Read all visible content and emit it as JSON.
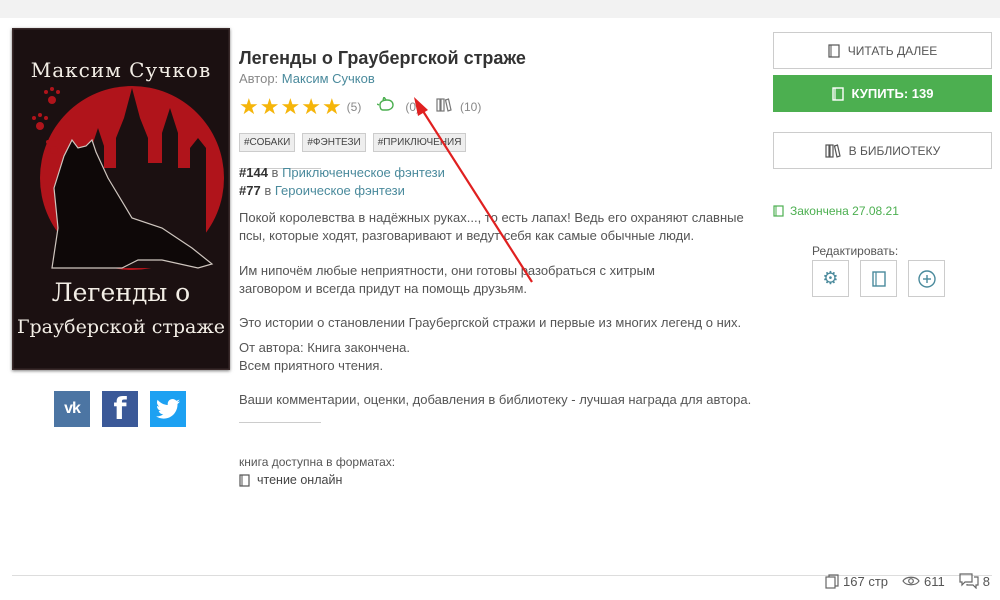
{
  "book": {
    "cover_author": "Максим Сучков",
    "cover_title_line1": "Легенды о",
    "cover_title_line2": "Грауберской страже",
    "title": "Легенды о Граубергской страже",
    "author_label": "Автор:",
    "author_name": "Максим Сучков",
    "rating_count": "(5)",
    "likes_count": "(0)",
    "library_count": "(10)",
    "tags": [
      "#СОБАКИ",
      "#ФЭНТЕЗИ",
      "#ПРИКЛЮЧЕНИЯ"
    ],
    "ranks": [
      {
        "num": "#144",
        "in": "в",
        "genre": "Приключенческое фэнтези"
      },
      {
        "num": "#77",
        "in": "в",
        "genre": "Героическое фэнтези"
      }
    ],
    "description": {
      "p1_l1": "Покой королевства в надёжных руках..., то есть лапах! Ведь его охраняют славные",
      "p1_l2": "псы, которые ходят, разговаривают и ведут себя как самые обычные люди.",
      "p2_l1": "Им нипочём любые неприятности, они готовы разобраться с хитрым",
      "p2_l2": "заговором и всегда придут на помощь друзьям.",
      "p3": "Это истории о становлении Граубергской стражи и первые из многих легенд о них.",
      "p4_l1": "От автора: Книга закончена.",
      "p4_l2": "Всем приятного чтения.",
      "p5": "Ваши комментарии, оценки, добавления в библиотеку - лучшая награда для автора."
    },
    "formats_label": "книга доступна в форматах:",
    "format_online": "чтение онлайн"
  },
  "social": {
    "vk": "vk",
    "fb": "f"
  },
  "actions": {
    "read_more": "ЧИТАТЬ ДАЛЕЕ",
    "buy": "КУПИТЬ: 139",
    "add_library": "В БИБЛИОТЕКУ",
    "status": "Закончена 27.08.21",
    "edit_label": "Редактировать:"
  },
  "stats": {
    "pages": "167 стр",
    "views": "611",
    "comments": "8"
  },
  "colors": {
    "accent_green": "#4caf50",
    "link": "#4a8a9c",
    "star": "#f5b50a",
    "annotation_arrow": "#e02020"
  }
}
